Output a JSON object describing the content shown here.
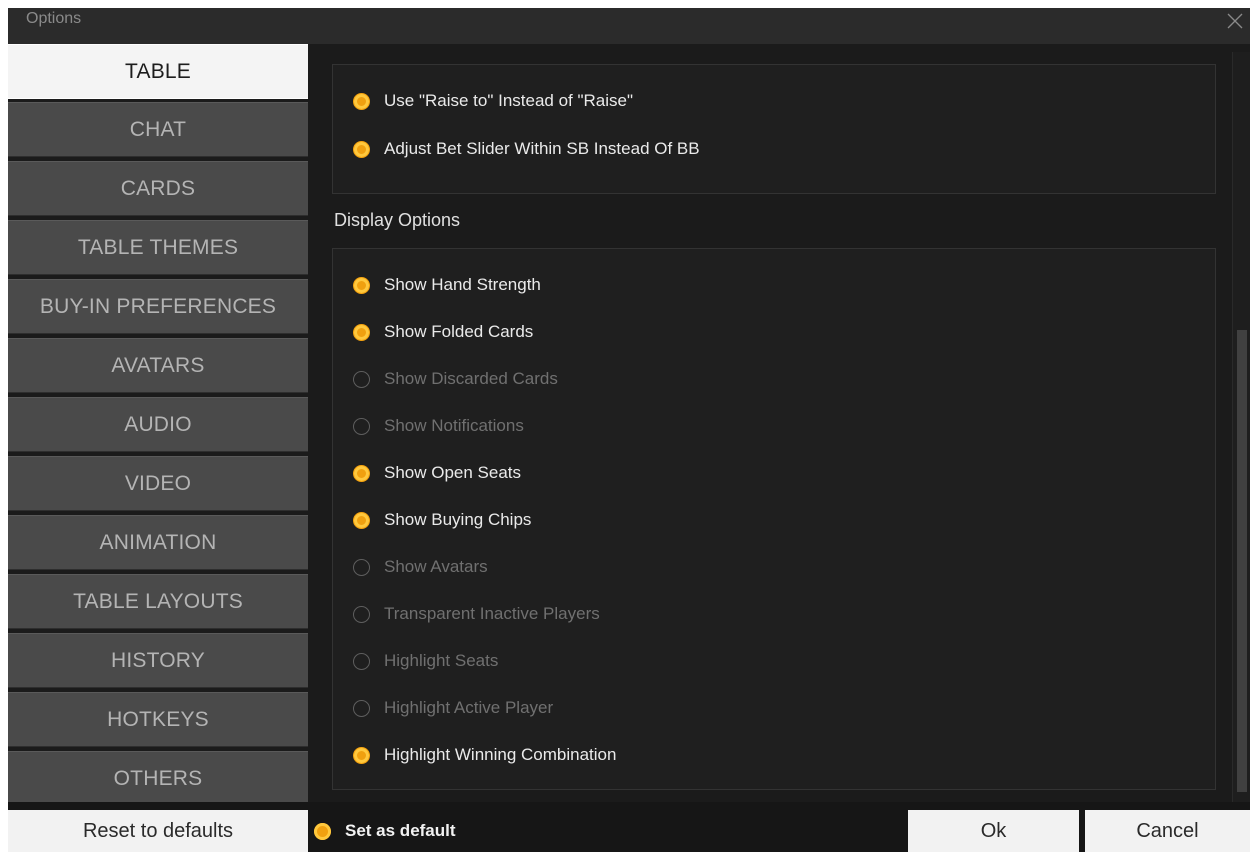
{
  "window": {
    "title": "Options"
  },
  "sidebar": {
    "items": [
      {
        "label": "TABLE",
        "active": true
      },
      {
        "label": "CHAT",
        "active": false
      },
      {
        "label": "CARDS",
        "active": false
      },
      {
        "label": "TABLE THEMES",
        "active": false
      },
      {
        "label": "BUY-IN PREFERENCES",
        "active": false
      },
      {
        "label": "AVATARS",
        "active": false
      },
      {
        "label": "AUDIO",
        "active": false
      },
      {
        "label": "VIDEO",
        "active": false
      },
      {
        "label": "ANIMATION",
        "active": false
      },
      {
        "label": "TABLE LAYOUTS",
        "active": false
      },
      {
        "label": "HISTORY",
        "active": false
      },
      {
        "label": "HOTKEYS",
        "active": false
      },
      {
        "label": "OTHERS",
        "active": false
      }
    ]
  },
  "betting_options": [
    {
      "label": "Use \"Raise to\" Instead of \"Raise\"",
      "checked": true
    },
    {
      "label": "Adjust Bet Slider Within SB Instead Of BB",
      "checked": true
    }
  ],
  "display_options": {
    "heading": "Display Options",
    "items": [
      {
        "label": "Show Hand Strength",
        "checked": true
      },
      {
        "label": "Show Folded Cards",
        "checked": true
      },
      {
        "label": "Show Discarded Cards",
        "checked": false
      },
      {
        "label": "Show Notifications",
        "checked": false
      },
      {
        "label": "Show Open Seats",
        "checked": true
      },
      {
        "label": "Show Buying Chips",
        "checked": true
      },
      {
        "label": "Show Avatars",
        "checked": false
      },
      {
        "label": "Transparent Inactive Players",
        "checked": false
      },
      {
        "label": "Highlight Seats",
        "checked": false
      },
      {
        "label": "Highlight Active Player",
        "checked": false
      },
      {
        "label": "Highlight Winning Combination",
        "checked": true
      }
    ]
  },
  "footer": {
    "reset_label": "Reset to defaults",
    "set_default_label": "Set as default",
    "set_default_checked": true,
    "ok_label": "Ok",
    "cancel_label": "Cancel"
  },
  "colors": {
    "accent": "#f0a010",
    "panel_bg": "#1b1b1b",
    "nav_bg": "#4a4a4a",
    "nav_active_bg": "#f4f4f4"
  },
  "icons": {
    "close": "close-icon"
  }
}
